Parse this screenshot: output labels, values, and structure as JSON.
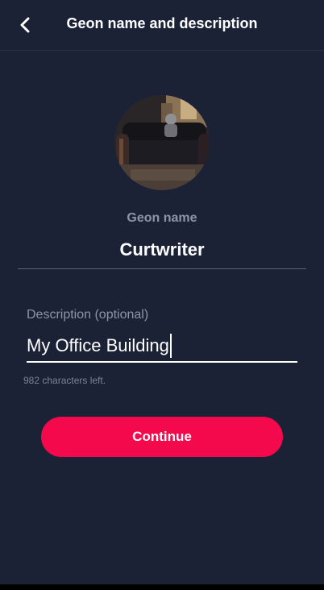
{
  "header": {
    "title": "Geon name and description",
    "back_icon": "chevron-left-icon"
  },
  "geon": {
    "name_label": "Geon name",
    "name_value": "Curtwriter"
  },
  "description": {
    "label": "Description (optional)",
    "value": "My Office Building",
    "chars_left": "982 characters left."
  },
  "actions": {
    "continue_label": "Continue"
  },
  "colors": {
    "background": "#1b2236",
    "accent": "#f5094d",
    "muted_text": "#8d94ab"
  }
}
